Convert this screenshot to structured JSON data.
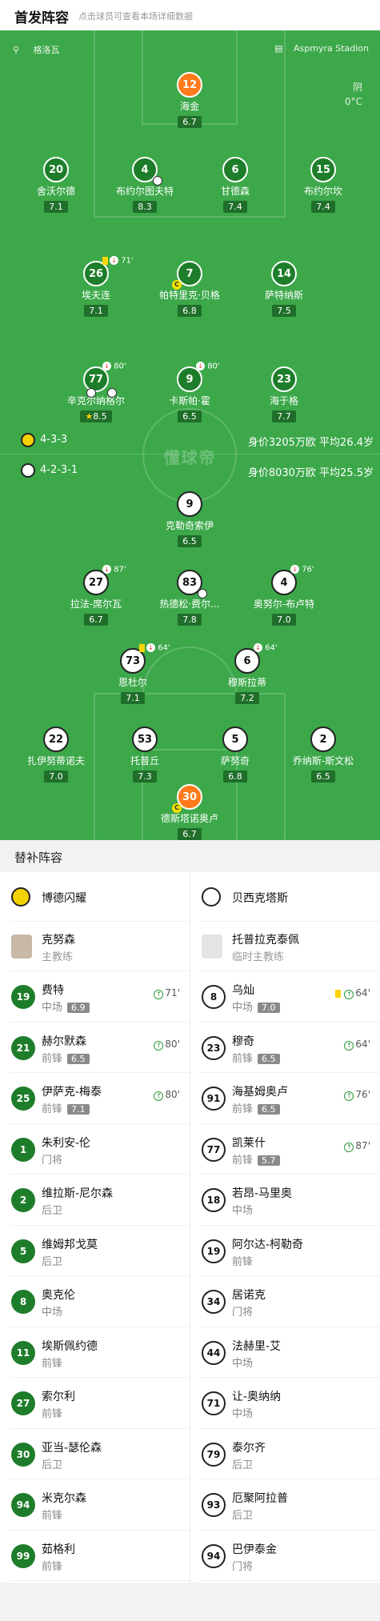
{
  "header": {
    "title": "首发阵容",
    "hint": "点击球员可查看本场详细数据"
  },
  "pitch": {
    "referee": "格洛瓦",
    "stadium": "Aspmyra Stadion",
    "weather": "阴",
    "temperature": "0°C",
    "watermark": "懂球帝",
    "home_team": {
      "formation": "4-3-3",
      "value": "身价3205万欧 平均26.4岁"
    },
    "away_team": {
      "formation": "4-2-3-1",
      "value": "身价8030万欧 平均25.5岁"
    },
    "home_players": [
      {
        "number": "12",
        "name": "海金",
        "rating": "6.7",
        "gk": true
      },
      {
        "number": "20",
        "name": "舍沃尔德",
        "rating": "7.1"
      },
      {
        "number": "4",
        "name": "布约尔图夫特",
        "rating": "8.3"
      },
      {
        "number": "6",
        "name": "甘德森",
        "rating": "7.4"
      },
      {
        "number": "15",
        "name": "布约尔坎",
        "rating": "7.4"
      },
      {
        "number": "26",
        "name": "埃夫连",
        "rating": "7.1",
        "sub_min": "71'"
      },
      {
        "number": "7",
        "name": "帕特里克·贝格",
        "rating": "6.8"
      },
      {
        "number": "14",
        "name": "萨特纳斯",
        "rating": "7.5"
      },
      {
        "number": "77",
        "name": "辛克尔纳格尔",
        "rating": "8.5",
        "sub_min": "80'"
      },
      {
        "number": "9",
        "name": "卡斯帕·霍",
        "rating": "6.5",
        "sub_min": "80'"
      },
      {
        "number": "23",
        "name": "海于格",
        "rating": "7.7"
      }
    ],
    "away_players": [
      {
        "number": "9",
        "name": "克勒奇索伊",
        "rating": "6.5"
      },
      {
        "number": "27",
        "name": "拉法-席尔瓦",
        "rating": "6.7",
        "sub_min": "87'"
      },
      {
        "number": "83",
        "name": "热德松·费尔...",
        "rating": "7.8"
      },
      {
        "number": "4",
        "name": "奥努尔-布卢特",
        "rating": "7.0",
        "sub_min": "76'"
      },
      {
        "number": "73",
        "name": "恩杜尔",
        "rating": "7.1",
        "sub_min": "64'"
      },
      {
        "number": "6",
        "name": "穆斯拉蒂",
        "rating": "7.2",
        "sub_min": "64'"
      },
      {
        "number": "22",
        "name": "扎伊努蒂诺夫",
        "rating": "7.0"
      },
      {
        "number": "53",
        "name": "托普丘",
        "rating": "7.3"
      },
      {
        "number": "5",
        "name": "萨努奇",
        "rating": "6.8"
      },
      {
        "number": "2",
        "name": "乔纳斯-斯文松",
        "rating": "6.5"
      },
      {
        "number": "30",
        "name": "德斯塔诺奥卢",
        "rating": "6.7",
        "gk": true
      }
    ]
  },
  "subs": {
    "title": "替补阵容",
    "home": {
      "team_name": "博德闪耀",
      "coach_name": "克努森",
      "coach_role": "主教练",
      "players": [
        {
          "number": "19",
          "name": "费特",
          "pos": "中场",
          "rating": "6.9",
          "min": "71'"
        },
        {
          "number": "21",
          "name": "赫尔默森",
          "pos": "前锋",
          "rating": "6.5",
          "min": "80'"
        },
        {
          "number": "25",
          "name": "伊萨克-梅泰",
          "pos": "前锋",
          "rating": "7.1",
          "min": "80'"
        },
        {
          "number": "1",
          "name": "朱利安-伦",
          "pos": "门将"
        },
        {
          "number": "2",
          "name": "维拉斯-尼尔森",
          "pos": "后卫"
        },
        {
          "number": "5",
          "name": "维姆邦戈莫",
          "pos": "后卫"
        },
        {
          "number": "8",
          "name": "奥克伦",
          "pos": "中场"
        },
        {
          "number": "11",
          "name": "埃斯佩约德",
          "pos": "前锋"
        },
        {
          "number": "27",
          "name": "索尔利",
          "pos": "前锋"
        },
        {
          "number": "30",
          "name": "亚当-瑟伦森",
          "pos": "后卫"
        },
        {
          "number": "94",
          "name": "米克尔森",
          "pos": "前锋"
        },
        {
          "number": "99",
          "name": "茹格利",
          "pos": "前锋"
        }
      ]
    },
    "away": {
      "team_name": "贝西克塔斯",
      "coach_name": "托普拉克泰佩",
      "coach_role": "临时主教练",
      "players": [
        {
          "number": "8",
          "name": "乌灿",
          "pos": "中场",
          "rating": "7.0",
          "min": "64'",
          "yellow": true
        },
        {
          "number": "23",
          "name": "穆奇",
          "pos": "前锋",
          "rating": "6.5",
          "min": "64'"
        },
        {
          "number": "91",
          "name": "海基姆奥卢",
          "pos": "前锋",
          "rating": "6.5",
          "min": "76'"
        },
        {
          "number": "77",
          "name": "凯莱什",
          "pos": "前锋",
          "rating": "5.7",
          "min": "87'"
        },
        {
          "number": "18",
          "name": "若昂-马里奥",
          "pos": "中场"
        },
        {
          "number": "19",
          "name": "阿尔达-柯勒奇",
          "pos": "前锋"
        },
        {
          "number": "34",
          "name": "居诺克",
          "pos": "门将"
        },
        {
          "number": "44",
          "name": "法赫里-艾",
          "pos": "中场"
        },
        {
          "number": "71",
          "name": "让-奥纳纳",
          "pos": "中场"
        },
        {
          "number": "79",
          "name": "泰尔齐",
          "pos": "后卫"
        },
        {
          "number": "93",
          "name": "厄聚阿拉普",
          "pos": "后卫"
        },
        {
          "number": "94",
          "name": "巴伊泰金",
          "pos": "门将"
        }
      ]
    }
  }
}
